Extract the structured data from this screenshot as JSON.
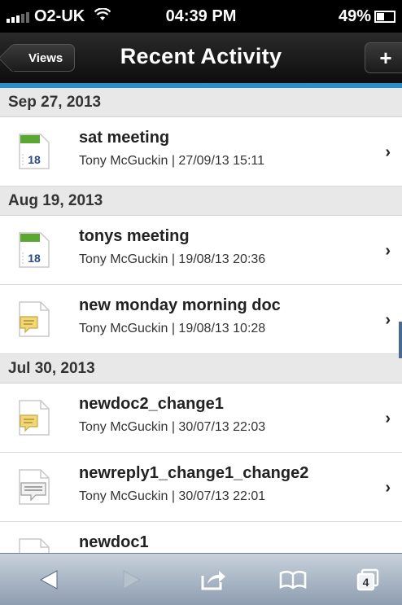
{
  "status_bar": {
    "carrier": "O2-UK",
    "time": "04:39 PM",
    "battery": "49%"
  },
  "nav": {
    "back_label": "Views",
    "title": "Recent Activity",
    "add_label": "+"
  },
  "sections": [
    {
      "date": "Sep 27, 2013",
      "items": [
        {
          "icon": "calendar-icon",
          "icon_text": "18",
          "title": "sat meeting",
          "meta": "Tony McGuckin | 27/09/13 15:11"
        }
      ]
    },
    {
      "date": "Aug 19, 2013",
      "items": [
        {
          "icon": "calendar-icon",
          "icon_text": "18",
          "title": "tonys meeting",
          "meta": "Tony McGuckin | 19/08/13 20:36"
        },
        {
          "icon": "comment-doc-icon",
          "title": "new monday morning doc",
          "meta": "Tony McGuckin | 19/08/13 10:28"
        }
      ]
    },
    {
      "date": "Jul 30, 2013",
      "items": [
        {
          "icon": "comment-doc-icon",
          "title": "newdoc2_change1",
          "meta": "Tony McGuckin | 30/07/13 22:03"
        },
        {
          "icon": "reply-doc-icon",
          "title": "newreply1_change1_change2",
          "meta": "Tony McGuckin | 30/07/13 22:01"
        },
        {
          "icon": "doc-icon",
          "title": "newdoc1",
          "meta": ""
        }
      ]
    }
  ],
  "toolbar": {
    "tabs_count": "4",
    "colors": {
      "accent": "#2d8dc8",
      "toolbar": "#aab6c5"
    }
  }
}
